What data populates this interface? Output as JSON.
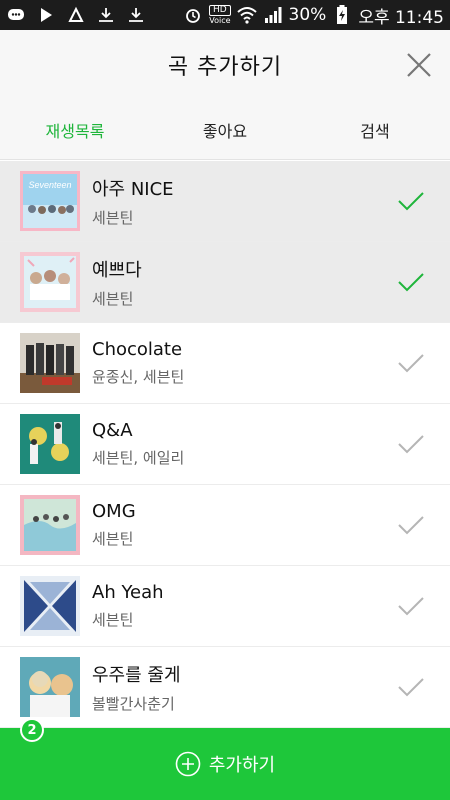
{
  "status_bar": {
    "battery": "30%",
    "clock": "오후 11:45",
    "hd_label": "HD",
    "voice_label": "Voice"
  },
  "header": {
    "title": "곡 추가하기"
  },
  "tabs": [
    {
      "label": "재생목록",
      "active": true
    },
    {
      "label": "좋아요",
      "active": false
    },
    {
      "label": "검색",
      "active": false
    }
  ],
  "songs": [
    {
      "title": "아주 NICE",
      "artist": "세븐틴",
      "selected": true,
      "art_text": "Seventeen"
    },
    {
      "title": "예쁘다",
      "artist": "세븐틴",
      "selected": true,
      "art_text": ""
    },
    {
      "title": "Chocolate",
      "artist": "윤종신, 세븐틴",
      "selected": false,
      "art_text": ""
    },
    {
      "title": "Q&A",
      "artist": "세븐틴, 에일리",
      "selected": false,
      "art_text": ""
    },
    {
      "title": "OMG",
      "artist": "세븐틴",
      "selected": false,
      "art_text": ""
    },
    {
      "title": "Ah Yeah",
      "artist": "세븐틴",
      "selected": false,
      "art_text": ""
    },
    {
      "title": "우주를 줄게",
      "artist": "볼빨간사춘기",
      "selected": false,
      "art_text": ""
    }
  ],
  "add_bar": {
    "label": "추가하기",
    "count": "2"
  },
  "colors": {
    "accent": "#1ec73a",
    "tab_active": "#1fb53b",
    "selected_row": "#ebebeb"
  }
}
